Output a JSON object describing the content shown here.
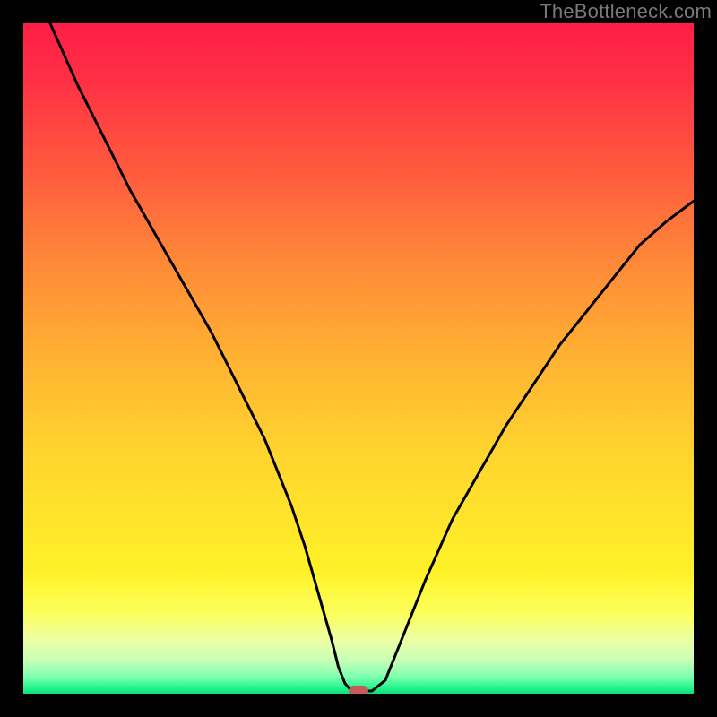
{
  "watermark": "TheBottleneck.com",
  "chart_data": {
    "type": "line",
    "title": "",
    "xlabel": "",
    "ylabel": "",
    "xlim": [
      0,
      100
    ],
    "ylim": [
      0,
      100
    ],
    "grid": false,
    "curve": {
      "x": [
        4,
        8,
        12,
        16,
        20,
        24,
        28,
        32,
        36,
        40,
        42,
        44,
        46,
        47,
        48,
        49,
        51,
        52,
        54,
        56,
        60,
        64,
        68,
        72,
        76,
        80,
        84,
        88,
        92,
        96,
        100
      ],
      "y": [
        100,
        91,
        83,
        75,
        68,
        61,
        54,
        46,
        38,
        28,
        22,
        15,
        8,
        4,
        1.5,
        0.4,
        0.4,
        0.4,
        2,
        7,
        17,
        26,
        33,
        40,
        46,
        52,
        57,
        62,
        67,
        70.5,
        73.5
      ]
    },
    "marker": {
      "x": 50,
      "y": 0.4
    },
    "background_gradient": {
      "top": "#ff1e46",
      "bottom": "#0adf7a"
    }
  }
}
